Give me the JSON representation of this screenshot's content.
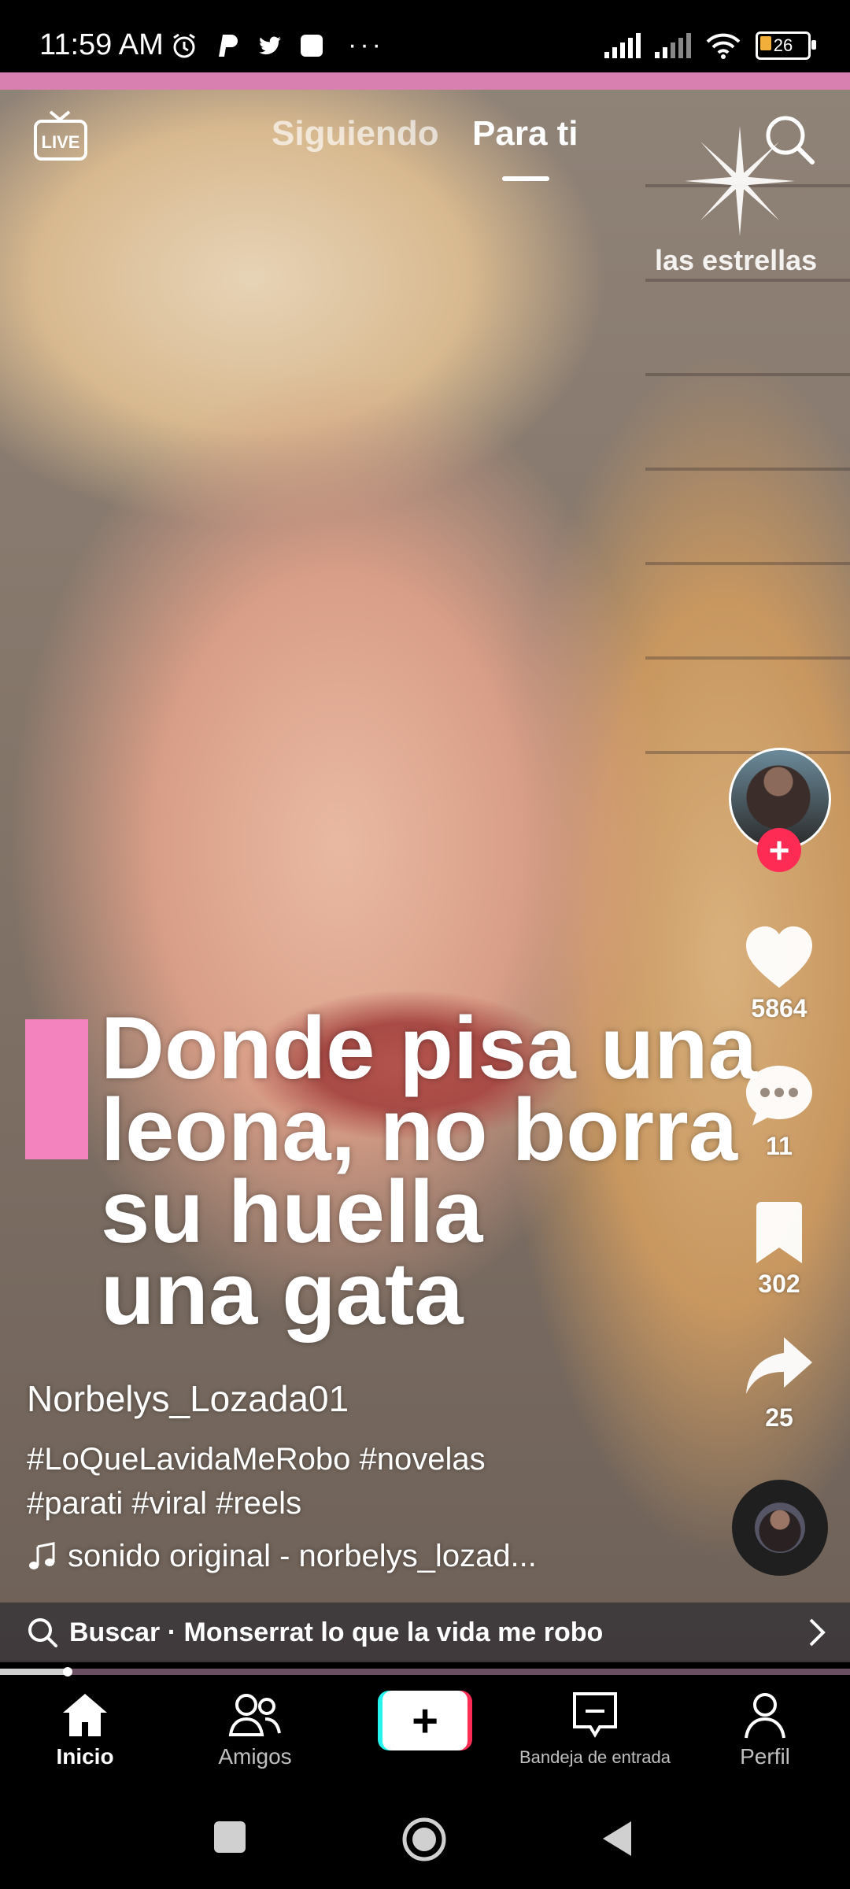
{
  "status_bar": {
    "time": "11:59 AM",
    "battery": "26",
    "more": "···"
  },
  "top_nav": {
    "live_label": "LIVE",
    "tab_following": "Siguiendo",
    "tab_for_you": "Para ti"
  },
  "watermark": {
    "text": "las estrellas"
  },
  "caption": {
    "line1": "Donde pisa una",
    "line2": "leona, no borra",
    "line3": "su huella",
    "line4": "una gata"
  },
  "rail": {
    "likes": "5864",
    "comments": "11",
    "saves": "302",
    "shares": "25",
    "follow_symbol": "+"
  },
  "post": {
    "username": "Norbelys_Lozada01",
    "hashtags_line1": "#LoQueLavidaMeRobo #novelas",
    "hashtags_line2": "#parati #viral #reels",
    "sound": "sonido original - norbelys_lozad..."
  },
  "search_suggestion": {
    "text": "Buscar · Monserrat lo que la vida me robo"
  },
  "bottom_nav": {
    "home": "Inicio",
    "friends": "Amigos",
    "create": "+",
    "inbox": "Bandeja de entrada",
    "profile": "Perfil"
  },
  "colors": {
    "accent_red": "#fe2c55",
    "accent_cyan": "#25f4ee",
    "caption_pink": "#f283be"
  },
  "progress_fraction": 0.08
}
